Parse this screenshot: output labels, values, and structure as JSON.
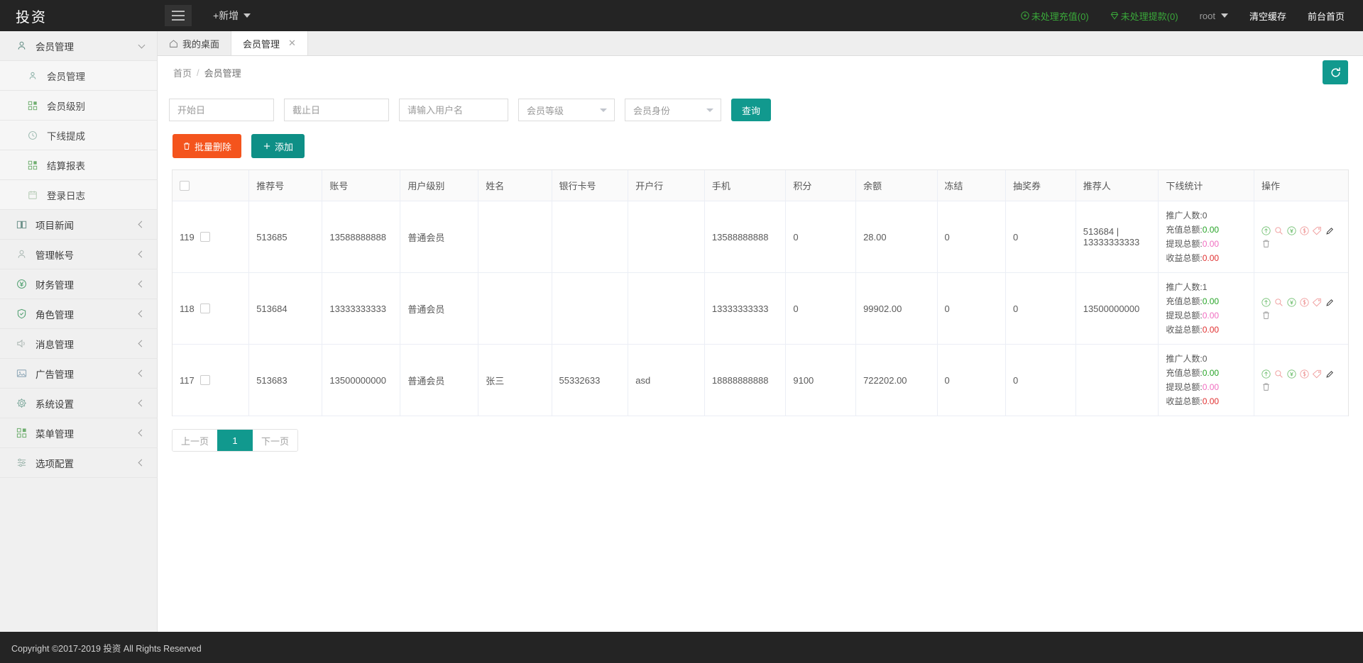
{
  "app": {
    "brand": "投资"
  },
  "topbar": {
    "add_label": "+新增",
    "pending_recharge": "未处理充值(0)",
    "pending_withdraw": "未处理提款(0)",
    "user": "root",
    "clear_cache": "清空缓存",
    "front_home": "前台首页"
  },
  "sidebar": {
    "items": [
      {
        "label": "会员管理",
        "icon": "user-icon",
        "type": "group",
        "expanded": true
      },
      {
        "label": "会员管理",
        "icon": "user-icon",
        "type": "sub"
      },
      {
        "label": "会员级别",
        "icon": "grid-icon",
        "type": "sub"
      },
      {
        "label": "下线提成",
        "icon": "clock-icon",
        "type": "sub"
      },
      {
        "label": "结算报表",
        "icon": "grid-icon",
        "type": "sub"
      },
      {
        "label": "登录日志",
        "icon": "calendar-icon",
        "type": "sub"
      },
      {
        "label": "项目新闻",
        "icon": "book-icon",
        "type": "group"
      },
      {
        "label": "管理帐号",
        "icon": "user-circle-icon",
        "type": "group"
      },
      {
        "label": "财务管理",
        "icon": "yen-circle-icon",
        "type": "group"
      },
      {
        "label": "角色管理",
        "icon": "shield-icon",
        "type": "group"
      },
      {
        "label": "消息管理",
        "icon": "speaker-icon",
        "type": "group"
      },
      {
        "label": "广告管理",
        "icon": "image-icon",
        "type": "group"
      },
      {
        "label": "系统设置",
        "icon": "gear-icon",
        "type": "group"
      },
      {
        "label": "菜单管理",
        "icon": "menu-grid-icon",
        "type": "group"
      },
      {
        "label": "选项配置",
        "icon": "sliders-icon",
        "type": "group"
      }
    ]
  },
  "tabs": [
    {
      "label": "我的桌面",
      "icon": "home-icon",
      "active": false,
      "closable": false
    },
    {
      "label": "会员管理",
      "icon": "",
      "active": true,
      "closable": true,
      "close": "✕"
    }
  ],
  "breadcrumb": {
    "home": "首页",
    "sep": "/",
    "current": "会员管理"
  },
  "filters": {
    "start_date_placeholder": "开始日",
    "start_date_value": "",
    "end_date_placeholder": "截止日",
    "end_date_value": "",
    "username_placeholder": "请输入用户名",
    "username_value": "",
    "level_selected": "会员等级",
    "identity_selected": "会员身份",
    "query_label": "查询"
  },
  "toolbar": {
    "batch_delete_label": "批量删除",
    "add_label": "添加"
  },
  "table": {
    "columns": [
      "",
      "推荐号",
      "账号",
      "用户级别",
      "姓名",
      "银行卡号",
      "开户行",
      "手机",
      "积分",
      "余额",
      "冻结",
      "抽奖券",
      "推荐人",
      "下线统计",
      "操作"
    ],
    "stat_labels": {
      "promoters": "推广人数:",
      "recharge_total": "充值总额:",
      "withdraw_total": "提现总额:",
      "profit_total": "收益总额:"
    },
    "rows": [
      {
        "id": "119",
        "referral_no": "513685",
        "account": "13588888888",
        "level": "普通会员",
        "name": "",
        "bank_card": "",
        "bank": "",
        "phone": "13588888888",
        "points": "0",
        "balance": "28.00",
        "frozen": "0",
        "lottery": "0",
        "referrer": "513684 | 13333333333",
        "stats": {
          "promoters": "0",
          "recharge_total": "0.00",
          "withdraw_total": "0.00",
          "profit_total": "0.00"
        }
      },
      {
        "id": "118",
        "referral_no": "513684",
        "account": "13333333333",
        "level": "普通会员",
        "name": "",
        "bank_card": "",
        "bank": "",
        "phone": "13333333333",
        "points": "0",
        "balance": "99902.00",
        "frozen": "0",
        "lottery": "0",
        "referrer": "13500000000",
        "stats": {
          "promoters": "1",
          "recharge_total": "0.00",
          "withdraw_total": "0.00",
          "profit_total": "0.00"
        }
      },
      {
        "id": "117",
        "referral_no": "513683",
        "account": "13500000000",
        "level": "普通会员",
        "name": "张三",
        "bank_card": "55332633",
        "bank": "asd",
        "phone": "18888888888",
        "points": "9100",
        "balance": "722202.00",
        "frozen": "0",
        "lottery": "0",
        "referrer": "",
        "stats": {
          "promoters": "0",
          "recharge_total": "0.00",
          "withdraw_total": "0.00",
          "profit_total": "0.00"
        }
      }
    ],
    "row_action_icons": [
      "upload-circle-icon",
      "search-icon",
      "yen-circle-icon",
      "dollar-circle-icon",
      "tag-icon",
      "edit-pencil-icon",
      "trash-icon"
    ]
  },
  "pagination": {
    "prev": "上一页",
    "current": "1",
    "next": "下一页"
  },
  "footer": {
    "copyright": "Copyright ©2017-2019 投资 All Rights Reserved"
  },
  "colors": {
    "accent_teal": "#11998e",
    "danger_orange": "#f4541d",
    "dark_bar": "#242424",
    "green": "#3aa93a",
    "pink": "#f06ec0",
    "red": "#e03131"
  }
}
